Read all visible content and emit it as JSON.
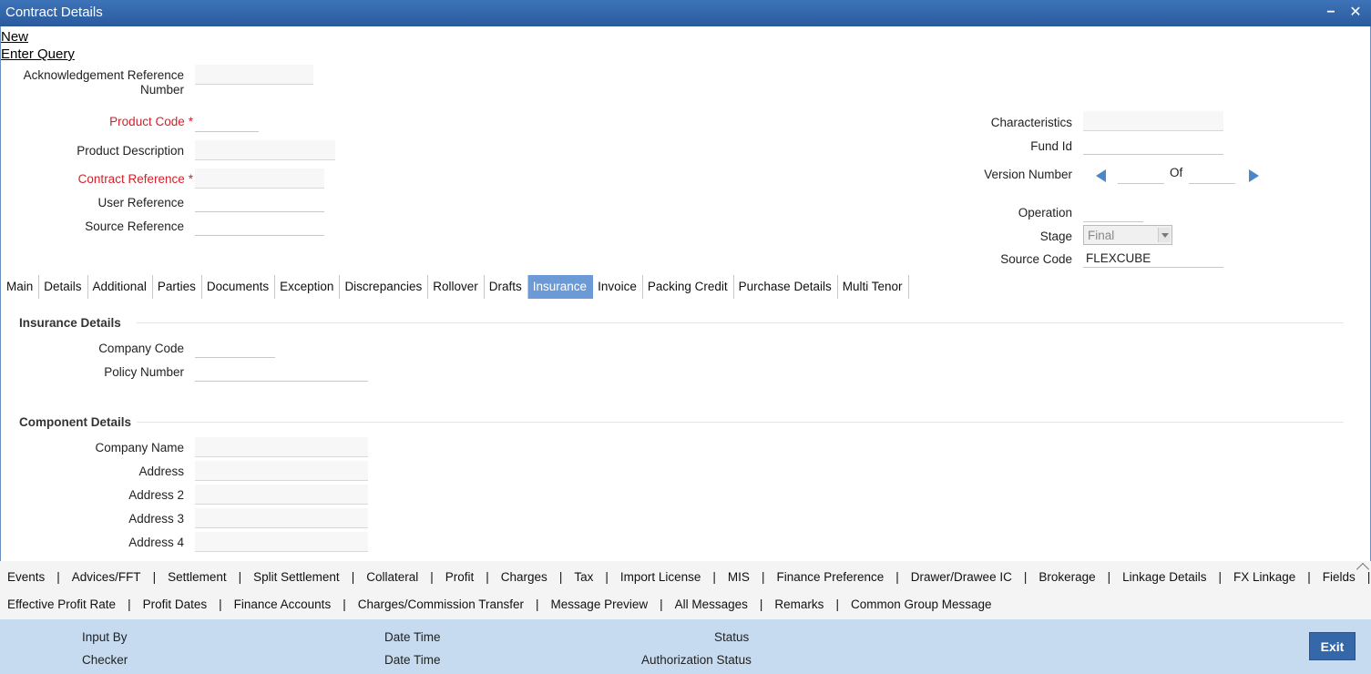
{
  "window": {
    "title": "Contract Details",
    "minimize": "−",
    "close": "✕"
  },
  "menu": {
    "new": "New",
    "enter_query": "Enter Query"
  },
  "form_left": {
    "ack_ref_label_1": "Acknowledgement Reference",
    "ack_ref_label_2": "Number",
    "product_code_label": "Product Code",
    "product_desc_label": "Product Description",
    "contract_ref_label": "Contract Reference",
    "user_ref_label": "User Reference",
    "source_ref_label": "Source Reference",
    "required_marker": "*"
  },
  "form_right": {
    "characteristics_label": "Characteristics",
    "fund_id_label": "Fund Id",
    "version_label": "Version Number",
    "of_label": "Of",
    "operation_label": "Operation",
    "stage_label": "Stage",
    "stage_value": "Final",
    "source_code_label": "Source Code",
    "source_code_value": "FLEXCUBE"
  },
  "tabs": [
    "Main",
    "Details",
    "Additional",
    "Parties",
    "Documents",
    "Exception",
    "Discrepancies",
    "Rollover",
    "Drafts",
    "Insurance",
    "Invoice",
    "Packing Credit",
    "Purchase Details",
    "Multi Tenor"
  ],
  "active_tab": "Insurance",
  "insurance": {
    "section_title": "Insurance Details",
    "company_code_label": "Company Code",
    "policy_number_label": "Policy Number"
  },
  "component": {
    "section_title": "Component Details",
    "company_name_label": "Company Name",
    "address_label": "Address",
    "address2_label": "Address 2",
    "address3_label": "Address 3",
    "address4_label": "Address 4"
  },
  "bottom_links_row1": [
    "Events",
    "Advices/FFT",
    "Settlement",
    "Split Settlement",
    "Collateral",
    "Profit",
    "Charges",
    "Tax",
    "Import License",
    "MIS",
    "Finance Preference",
    "Drawer/Drawee IC",
    "Brokerage",
    "Linkage Details",
    "FX Linkage",
    "Fields"
  ],
  "bottom_links_row2": [
    "Effective Profit Rate",
    "Profit Dates",
    "Finance Accounts",
    "Charges/Commission Transfer",
    "Message Preview",
    "All Messages",
    "Remarks",
    "Common Group Message"
  ],
  "link_separator": "|",
  "footer": {
    "input_by": "Input By",
    "checker": "Checker",
    "date_time_1": "Date Time",
    "date_time_2": "Date Time",
    "status": "Status",
    "auth_status": "Authorization Status",
    "exit": "Exit"
  },
  "colors": {
    "titlebar": "#2f62a8",
    "active_tab": "#6c9ad6",
    "required": "#d5202a",
    "footer": "#c6dbef",
    "exit_button": "#3568a8"
  }
}
